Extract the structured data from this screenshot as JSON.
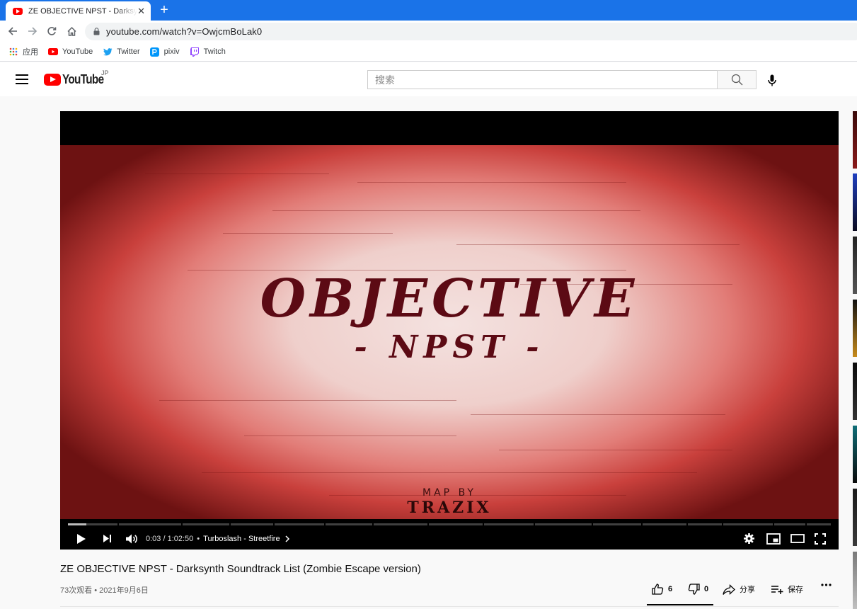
{
  "browser": {
    "tab_title": "ZE OBJECTIVE NPST - Darksynth Soundtrack List (Zombie Escape version) - YouTube",
    "url": "youtube.com/watch?v=OwjcmBoLak0",
    "bookmarks": [
      {
        "label": "应用",
        "icon": "apps-grid-icon"
      },
      {
        "label": "YouTube",
        "icon": "youtube-icon"
      },
      {
        "label": "Twitter",
        "icon": "twitter-icon"
      },
      {
        "label": "pixiv",
        "icon": "pixiv-icon"
      },
      {
        "label": "Twitch",
        "icon": "twitch-icon"
      }
    ]
  },
  "masthead": {
    "logo_text": "YouTube",
    "country": "JP",
    "search_placeholder": "搜索"
  },
  "player": {
    "frame_title": "OBJECTIVE",
    "frame_subtitle": "- NPST -",
    "frame_credit_small": "MAP BY",
    "frame_credit": "TRAZIX",
    "time_current": "0:03",
    "time_separator": " / ",
    "time_total": "1:02:50",
    "chapter_separator": "•",
    "chapter_title": "Turboslash - Streetfire",
    "progress_fraction": 0.0008
  },
  "video": {
    "title": "ZE OBJECTIVE NPST - Darksynth Soundtrack List (Zombie Escape version)",
    "views": "73次观看",
    "date_separator": "•",
    "date": "2021年9月6日",
    "likes": "6",
    "dislikes": "0",
    "share_label": "分享",
    "save_label": "保存"
  },
  "colors": {
    "chrome_blue": "#1a73e8",
    "youtube_red": "#ff0000",
    "frame_red": "#c9403c",
    "frame_text": "#5c0a14"
  }
}
